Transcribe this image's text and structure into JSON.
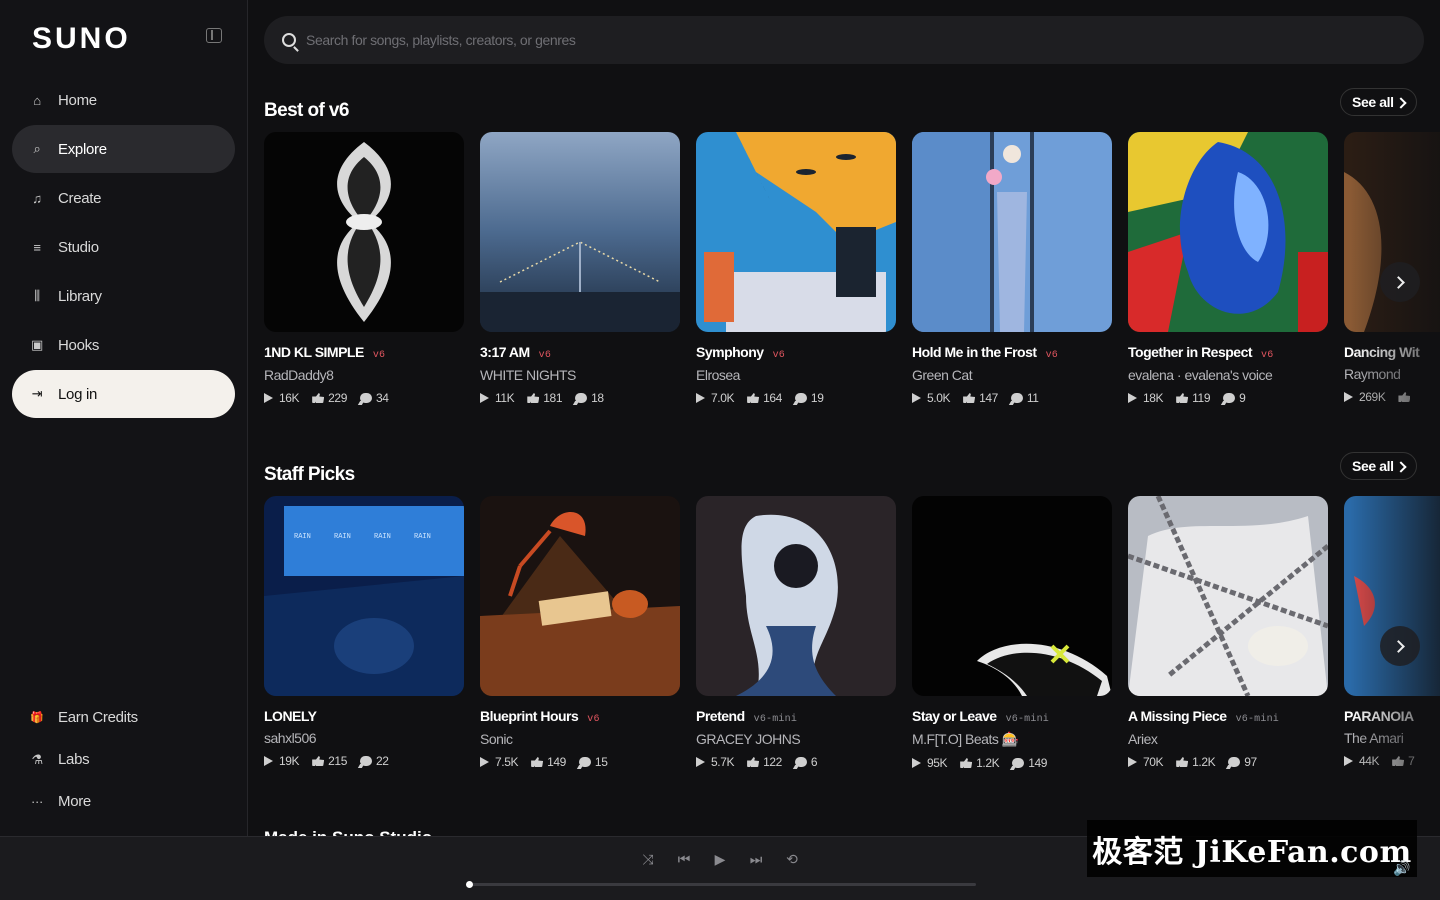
{
  "app": {
    "logo": "SUNO"
  },
  "sidebar": {
    "items": [
      {
        "label": "Home",
        "icon": "home-icon",
        "glyph": "⌂"
      },
      {
        "label": "Explore",
        "icon": "search-icon",
        "glyph": "⌕"
      },
      {
        "label": "Create",
        "icon": "music-note-icon",
        "glyph": "♫"
      },
      {
        "label": "Studio",
        "icon": "sliders-icon",
        "glyph": "≡"
      },
      {
        "label": "Library",
        "icon": "library-icon",
        "glyph": "⫼"
      },
      {
        "label": "Hooks",
        "icon": "play-square-icon",
        "glyph": "▣"
      },
      {
        "label": "Log in",
        "icon": "login-icon",
        "glyph": "⇥"
      }
    ],
    "bottom_items": [
      {
        "label": "Earn Credits",
        "icon": "gift-icon",
        "glyph": "🎁"
      },
      {
        "label": "Labs",
        "icon": "flask-icon",
        "glyph": "⚗"
      },
      {
        "label": "More",
        "icon": "more-dots-icon",
        "glyph": "···"
      }
    ]
  },
  "search": {
    "placeholder": "Search for songs, playlists, creators, or genres"
  },
  "sections": [
    {
      "title": "Best of v6",
      "see_all": "See all",
      "cards": [
        {
          "title": "1ND KL SIMPLE",
          "badge": "v6",
          "artist": "RadDaddy8",
          "plays": "16K",
          "likes": "229",
          "comments": "34"
        },
        {
          "title": "3:17 AM",
          "badge": "v6",
          "artist": "WHITE NIGHTS",
          "plays": "11K",
          "likes": "181",
          "comments": "18"
        },
        {
          "title": "Symphony",
          "badge": "v6",
          "artist": "Elrosea",
          "plays": "7.0K",
          "likes": "164",
          "comments": "19"
        },
        {
          "title": "Hold Me in the Frost",
          "badge": "v6",
          "artist": "Green Cat",
          "plays": "5.0K",
          "likes": "147",
          "comments": "11"
        },
        {
          "title": "Together in Respect",
          "badge": "v6",
          "artist": "evalena · evalena's voice",
          "plays": "18K",
          "likes": "119",
          "comments": "9"
        },
        {
          "title": "Dancing Wit",
          "badge": "",
          "artist": "Raymond",
          "plays": "269K",
          "likes": "",
          "comments": ""
        }
      ]
    },
    {
      "title": "Staff Picks",
      "see_all": "See all",
      "cards": [
        {
          "title": "LONELY",
          "badge": "",
          "artist": "sahxl506",
          "plays": "19K",
          "likes": "215",
          "comments": "22"
        },
        {
          "title": "Blueprint Hours",
          "badge": "v6",
          "artist": "Sonic",
          "plays": "7.5K",
          "likes": "149",
          "comments": "15"
        },
        {
          "title": "Pretend",
          "badge": "v6-mini",
          "artist": "GRACEY JOHNS",
          "plays": "5.7K",
          "likes": "122",
          "comments": "6"
        },
        {
          "title": "Stay or Leave",
          "badge": "v6-mini",
          "artist": "M.F[T.O] Beats 🎰",
          "plays": "95K",
          "likes": "1.2K",
          "comments": "149"
        },
        {
          "title": "A Missing Piece",
          "badge": "v6-mini",
          "artist": "Ariex",
          "plays": "70K",
          "likes": "1.2K",
          "comments": "97"
        },
        {
          "title": "PARANOIA",
          "badge": "",
          "artist": "The Amari",
          "plays": "44K",
          "likes": "7",
          "comments": ""
        }
      ]
    }
  ],
  "peek_section_title": "Made in Suno Studio",
  "player": {
    "progress_fraction": 0.0,
    "controls": [
      "shuffle-icon",
      "previous-icon",
      "play-icon",
      "next-icon",
      "repeat-icon"
    ]
  },
  "watermark": "极客范 JiKeFan.com",
  "colors": {
    "badge_v6": "#e0555f",
    "accent_login": "#f4f1ec"
  }
}
